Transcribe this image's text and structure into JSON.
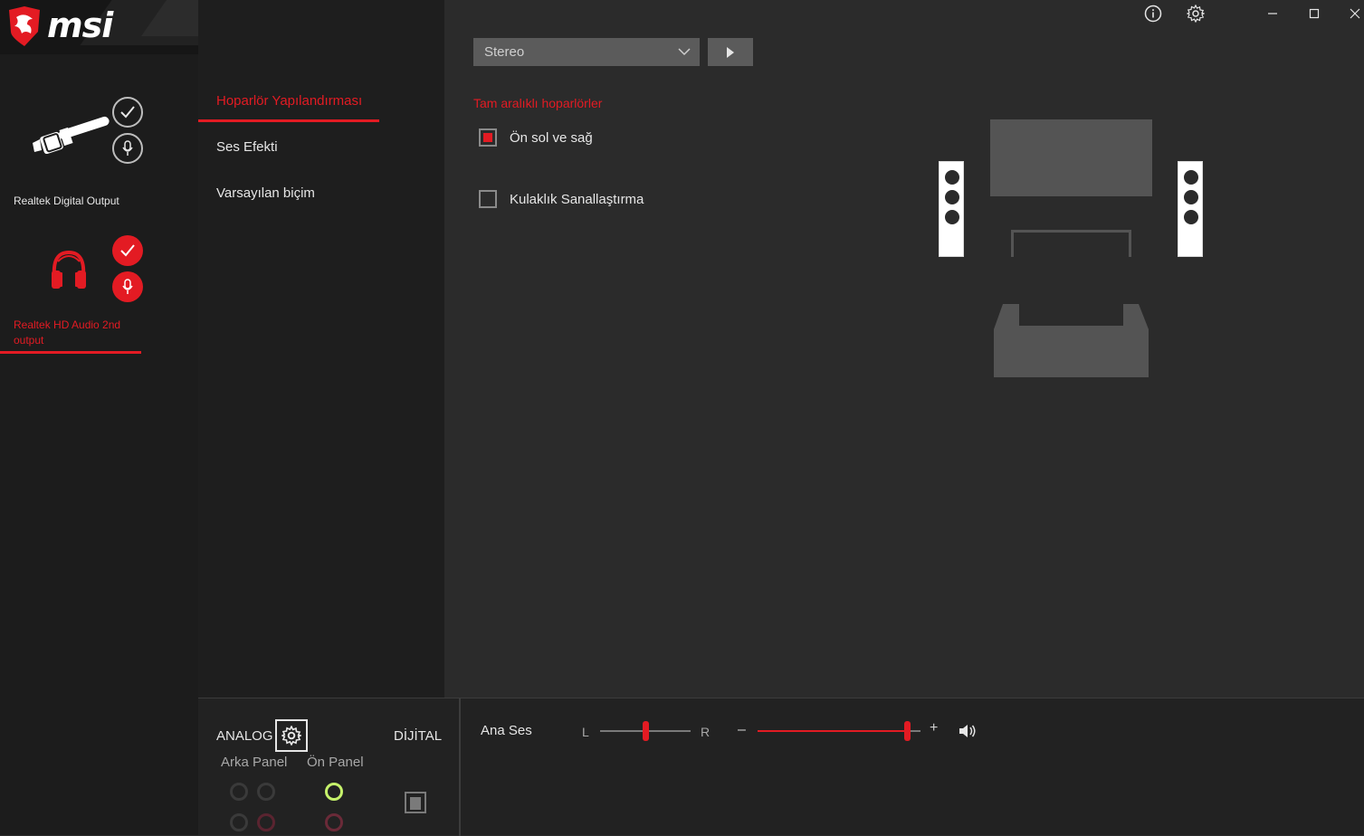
{
  "brand": {
    "logo_text": "msi",
    "accent_color": "#e31b23"
  },
  "devices": [
    {
      "label": "Realtek Digital Output",
      "icon": "rca-plug-icon",
      "active": false
    },
    {
      "label": "Realtek HD Audio 2nd output",
      "icon": "headphones-icon",
      "active": true
    }
  ],
  "nav": {
    "items": [
      {
        "label": "Hoparlör Yapılandırması",
        "active": true
      },
      {
        "label": "Ses Efekti",
        "active": false
      },
      {
        "label": "Varsayılan biçim",
        "active": false
      }
    ]
  },
  "window_controls": {
    "info": "info-icon",
    "settings": "gear-icon",
    "minimize": "minimize-icon",
    "maximize": "maximize-icon",
    "close": "close-icon"
  },
  "config": {
    "selected": "Stereo",
    "section_title": "Tam aralıklı hoparlörler",
    "checkboxes": [
      {
        "label": "Ön sol ve sağ",
        "checked": true
      },
      {
        "label": "Kulaklık Sanallaştırma",
        "checked": false
      }
    ]
  },
  "connectors": {
    "analog_label": "ANALOG",
    "digital_label": "DİJİTAL",
    "rear_panel_label": "Arka Panel",
    "front_panel_label": "Ön Panel"
  },
  "volume": {
    "label": "Ana Ses",
    "left_label": "L",
    "right_label": "R",
    "minus": "–",
    "plus": "+",
    "balance": 0.5,
    "level": 0.92
  }
}
